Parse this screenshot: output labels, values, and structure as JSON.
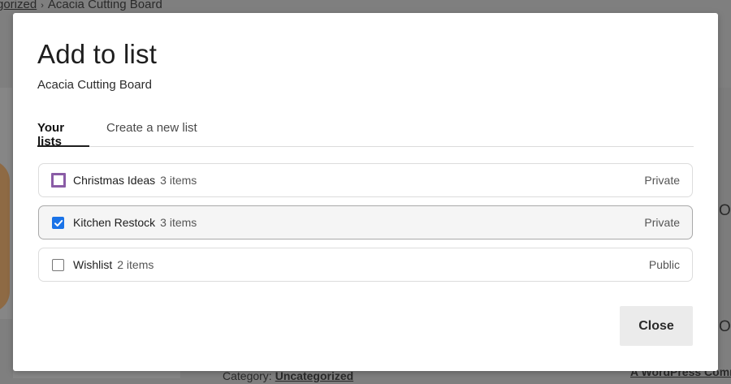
{
  "background": {
    "breadcrumb": {
      "link_text": "gorized",
      "separator": "›",
      "current": "Acacia Cutting Board"
    },
    "right_letter": "O",
    "category": {
      "label": "Category:",
      "link_text": "Uncategorized"
    },
    "footer_link": "A WordPress Comm"
  },
  "modal": {
    "title": "Add to list",
    "subtitle": "Acacia Cutting Board",
    "tabs": [
      {
        "label": "Your lists",
        "active": true
      },
      {
        "label": "Create a new list",
        "active": false
      }
    ],
    "lists": [
      {
        "name": "Christmas Ideas",
        "count": "3 items",
        "privacy": "Private",
        "checked": false,
        "focused": true
      },
      {
        "name": "Kitchen Restock",
        "count": "3 items",
        "privacy": "Private",
        "checked": true,
        "focused": false
      },
      {
        "name": "Wishlist",
        "count": "2 items",
        "privacy": "Public",
        "checked": false,
        "focused": false
      }
    ],
    "close_label": "Close"
  },
  "colors": {
    "overlay": "#7f7f7f",
    "checkbox_checked": "#1a73e8",
    "focus_outline": "#8a5ca6",
    "close_button_bg": "#ebebeb"
  },
  "icons": {
    "checkmark": "checkmark-icon"
  }
}
